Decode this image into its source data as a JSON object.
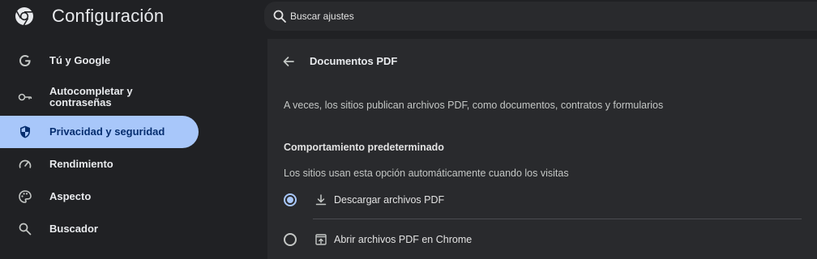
{
  "header": {
    "title": "Configuración",
    "search_placeholder": "Buscar ajustes",
    "logo_icon": "chrome-logo-icon",
    "search_icon": "search-icon"
  },
  "sidebar": {
    "items": [
      {
        "label": "Tú y Google",
        "icon": "google-g-icon",
        "active": false
      },
      {
        "label": "Autocompletar y contraseñas",
        "line1": "Autocompletar y",
        "line2": "contraseñas",
        "icon": "key-icon",
        "active": false
      },
      {
        "label": "Privacidad y seguridad",
        "icon": "shield-icon",
        "active": true
      },
      {
        "label": "Rendimiento",
        "icon": "speedometer-icon",
        "active": false
      },
      {
        "label": "Aspecto",
        "icon": "palette-icon",
        "active": false
      },
      {
        "label": "Buscador",
        "icon": "search-icon",
        "active": false
      }
    ]
  },
  "main": {
    "back_icon": "arrow-back-icon",
    "title": "Documentos PDF",
    "description": "A veces, los sitios publican archivos PDF, como documentos, contratos y formularios",
    "section_title": "Comportamiento predeterminado",
    "section_subtitle": "Los sitios usan esta opción automáticamente cuando los visitas",
    "options": [
      {
        "label": "Descargar archivos PDF",
        "icon": "download-icon",
        "selected": true
      },
      {
        "label": "Abrir archivos PDF en Chrome",
        "icon": "open-in-browser-icon",
        "selected": false
      }
    ]
  },
  "colors": {
    "background": "#202124",
    "panel": "#292a2d",
    "accent": "#a8c7fa",
    "active_text": "#062e6f",
    "text": "#e3e3e3"
  }
}
